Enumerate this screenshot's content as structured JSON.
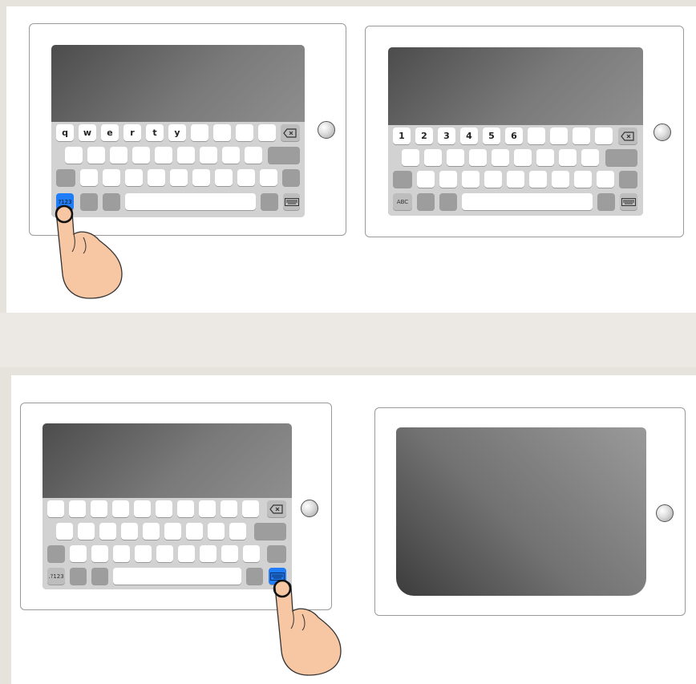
{
  "panels": [
    {
      "id": "letters",
      "row1_keys": [
        "q",
        "w",
        "e",
        "r",
        "t",
        "y",
        "",
        "",
        "",
        "",
        ""
      ],
      "mode_key": "?123",
      "mode_key_state": "pressed",
      "finger_on": "mode_key"
    },
    {
      "id": "numbers",
      "row1_keys": [
        "1",
        "2",
        "3",
        "4",
        "5",
        "6",
        "",
        "",
        "",
        ""
      ],
      "mode_key": "ABC",
      "mode_key_state": "normal"
    },
    {
      "id": "dismiss",
      "row1_keys": [
        "",
        "",
        "",
        "",
        "",
        "",
        "",
        "",
        "",
        "",
        ""
      ],
      "mode_key": ".?123",
      "mode_key_state": "normal",
      "hide_keyboard_key_state": "pressed",
      "finger_on": "hide_keyboard_key"
    },
    {
      "id": "keyboard-hidden"
    }
  ],
  "colors": {
    "highlight": "#1f7dfa",
    "skin": "#f7c6a3",
    "key": "#ffffff",
    "key_dark": "#9d9d9d",
    "keyboard_bg": "#d2d2d2"
  },
  "icons": [
    "delete-icon",
    "hide-keyboard-icon",
    "home-button",
    "pointing-finger"
  ]
}
